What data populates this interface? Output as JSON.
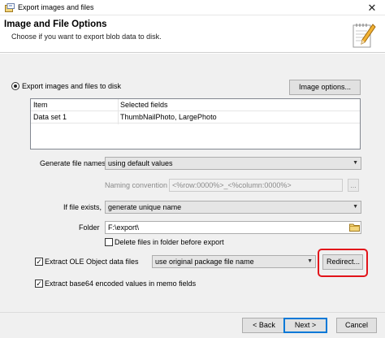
{
  "window": {
    "title": "Export images and files",
    "close_glyph": "✕"
  },
  "header": {
    "title": "Image and File Options",
    "subtitle": "Choose if you want to export blob data to disk."
  },
  "export_option": {
    "label": "Export images and files to disk",
    "selected": true
  },
  "image_options_button": "Image options...",
  "grid": {
    "columns": [
      "Item",
      "Selected fields"
    ],
    "rows": [
      [
        "Data set 1",
        "ThumbNailPhoto, LargePhoto"
      ]
    ]
  },
  "generate_file_names": {
    "label": "Generate file names",
    "value": "using default values"
  },
  "naming_convention": {
    "label": "Naming convention",
    "value": "<%row:0000%>_<%column:0000%>",
    "button": "..."
  },
  "if_file_exists": {
    "label": "If file exists,",
    "value": "generate unique name"
  },
  "folder": {
    "label": "Folder",
    "value": "F:\\export\\"
  },
  "delete_files": {
    "label": "Delete files in folder before export",
    "checked": false
  },
  "extract_ole": {
    "label": "Extract OLE Object data files",
    "checked": true,
    "value": "use original package file name",
    "redirect_button": "Redirect..."
  },
  "extract_base64": {
    "label": "Extract base64 encoded values in memo fields",
    "checked": true
  },
  "footer": {
    "back": "< Back",
    "next": "Next >",
    "cancel": "Cancel"
  },
  "icons": {
    "app": "export-app-icon",
    "header": "notepad-pencil-icon",
    "folder": "folder-icon"
  },
  "colors": {
    "highlight": "#e2141a",
    "primary_border": "#0078d7"
  }
}
